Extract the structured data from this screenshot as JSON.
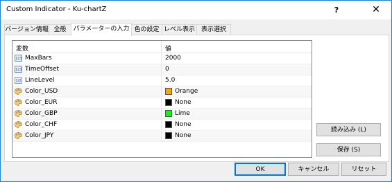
{
  "window": {
    "title": "Custom Indicator - Ku-chartZ",
    "help": "?",
    "close": "✕"
  },
  "tabs": [
    "バージョン情報",
    "全般",
    "パラメーターの入力",
    "色の設定",
    "レベル表示",
    "表示選択"
  ],
  "table": {
    "headers": {
      "name": "変数",
      "value": "値"
    },
    "rows": [
      {
        "icon": "integer-icon",
        "icon_text": "123",
        "name": "MaxBars",
        "value": "2000"
      },
      {
        "icon": "integer-icon",
        "icon_text": "123",
        "name": "TimeOffset",
        "value": "0"
      },
      {
        "icon": "double-icon",
        "icon_text": "1/2",
        "name": "LineLevel",
        "value": "5.0"
      },
      {
        "icon": "color-palette-icon",
        "name": "Color_USD",
        "value": "Orange",
        "swatch": "#ffa500"
      },
      {
        "icon": "color-palette-icon",
        "name": "Color_EUR",
        "value": "None",
        "swatch": "#000000"
      },
      {
        "icon": "color-palette-icon",
        "name": "Color_GBP",
        "value": "Lime",
        "swatch": "#00ff00"
      },
      {
        "icon": "color-palette-icon",
        "name": "Color_CHF",
        "value": "None",
        "swatch": "#000000"
      },
      {
        "icon": "color-palette-icon",
        "name": "Color_JPY",
        "value": "None",
        "swatch": "#000000"
      }
    ]
  },
  "buttons": {
    "load": "読み込み (L)",
    "save": "保存 (S)",
    "ok": "OK",
    "cancel": "キャンセル",
    "reset": "リセット"
  }
}
